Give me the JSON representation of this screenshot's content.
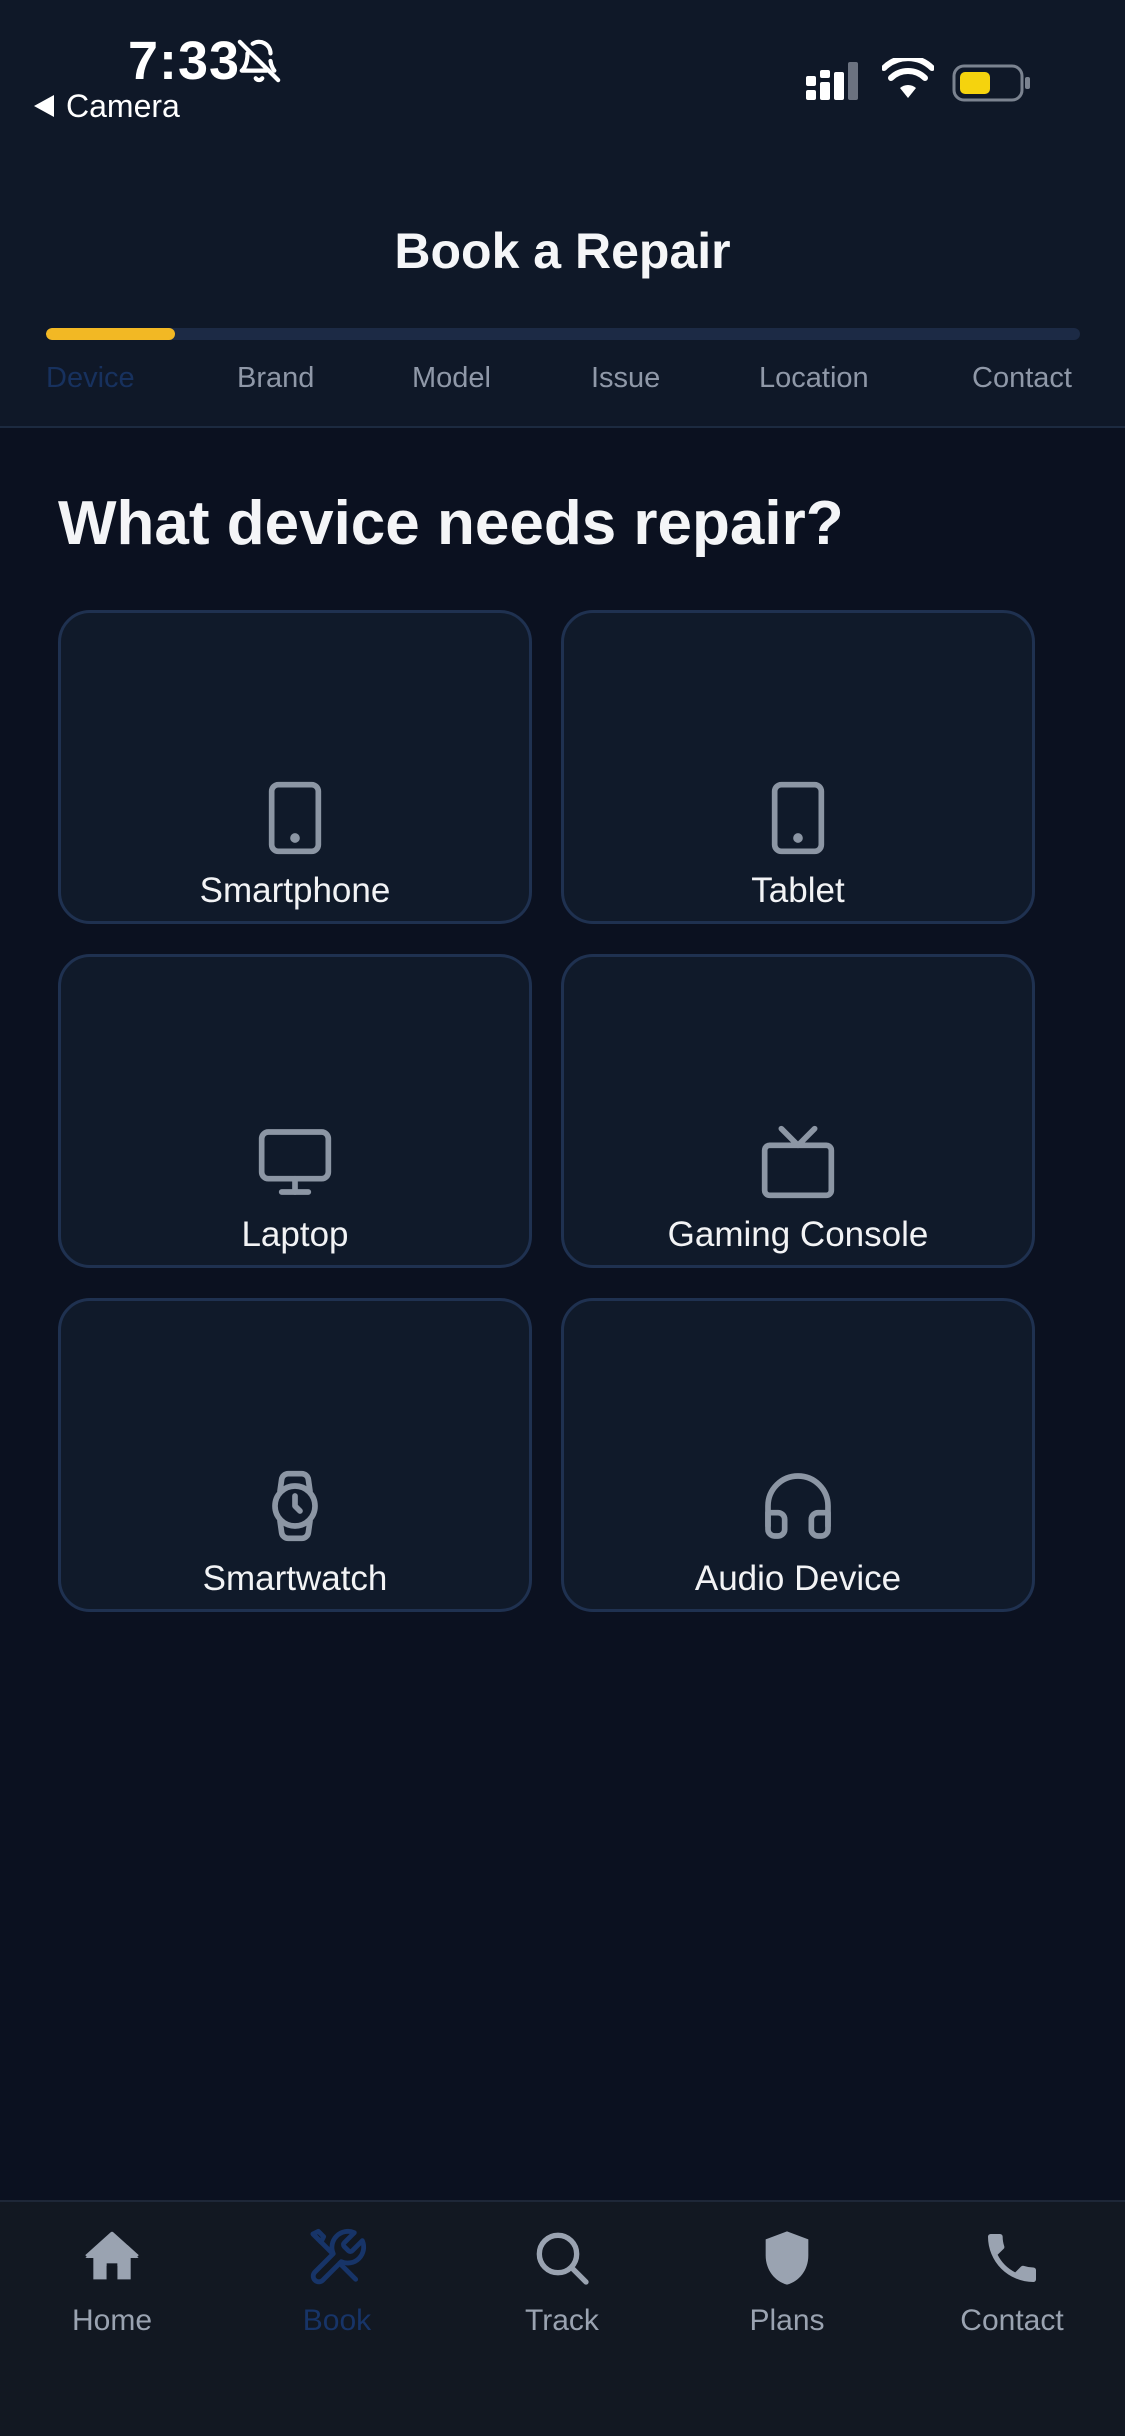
{
  "status_bar": {
    "time": "7:33",
    "back_label": "Camera"
  },
  "header": {
    "title": "Book a Repair",
    "progress_fraction": 0.125,
    "steps": [
      {
        "label": "Device",
        "active": true
      },
      {
        "label": "Brand",
        "active": false
      },
      {
        "label": "Model",
        "active": false
      },
      {
        "label": "Issue",
        "active": false
      },
      {
        "label": "Location",
        "active": false
      },
      {
        "label": "Contact",
        "active": false
      }
    ]
  },
  "main": {
    "question": "What device needs repair?",
    "devices": [
      {
        "label": "Smartphone",
        "icon": "smartphone-icon"
      },
      {
        "label": "Tablet",
        "icon": "tablet-icon"
      },
      {
        "label": "Laptop",
        "icon": "monitor-icon"
      },
      {
        "label": "Gaming Console",
        "icon": "tv-icon"
      },
      {
        "label": "Smartwatch",
        "icon": "watch-icon"
      },
      {
        "label": "Audio Device",
        "icon": "headphones-icon"
      }
    ]
  },
  "bottom_nav": {
    "items": [
      {
        "label": "Home",
        "icon": "home-icon",
        "active": false
      },
      {
        "label": "Book",
        "icon": "tools-icon",
        "active": true
      },
      {
        "label": "Track",
        "icon": "search-icon",
        "active": false
      },
      {
        "label": "Plans",
        "icon": "shield-icon",
        "active": false
      },
      {
        "label": "Contact",
        "icon": "phone-icon",
        "active": false
      }
    ]
  },
  "colors": {
    "background": "#0b1120",
    "header_background": "#0f1828",
    "accent": "#f2b824",
    "active_step": "#17315e",
    "card_border": "#1f3150",
    "icon_gray": "#8c96a4",
    "nav_active": "#173468"
  }
}
